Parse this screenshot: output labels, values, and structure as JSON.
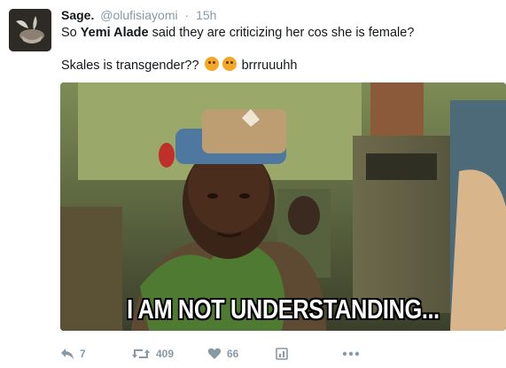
{
  "tweet": {
    "display_name": "Sage.",
    "handle": "@olufisiayomi",
    "separator": "·",
    "time": "15h",
    "text_line1_before": "So ",
    "text_line1_bold": "Yemi Alade",
    "text_line1_after": " said they are criticizing her cos she is female?",
    "text_line2_before": "Skales is transgender?? ",
    "text_line2_after": " brrruuuhh",
    "emojis": [
      "thinking-face",
      "thinking-face"
    ]
  },
  "media": {
    "caption": "I AM NOT UNDERSTANDING..."
  },
  "actions": {
    "reply_count": "7",
    "retweet_count": "409",
    "like_count": "66",
    "icons": [
      "reply-icon",
      "retweet-icon",
      "like-icon",
      "analytics-icon",
      "more-icon"
    ]
  },
  "colors": {
    "text": "#14171a",
    "muted": "#8899a6",
    "caption_text": "#ffffff",
    "caption_outline": "#000000"
  }
}
